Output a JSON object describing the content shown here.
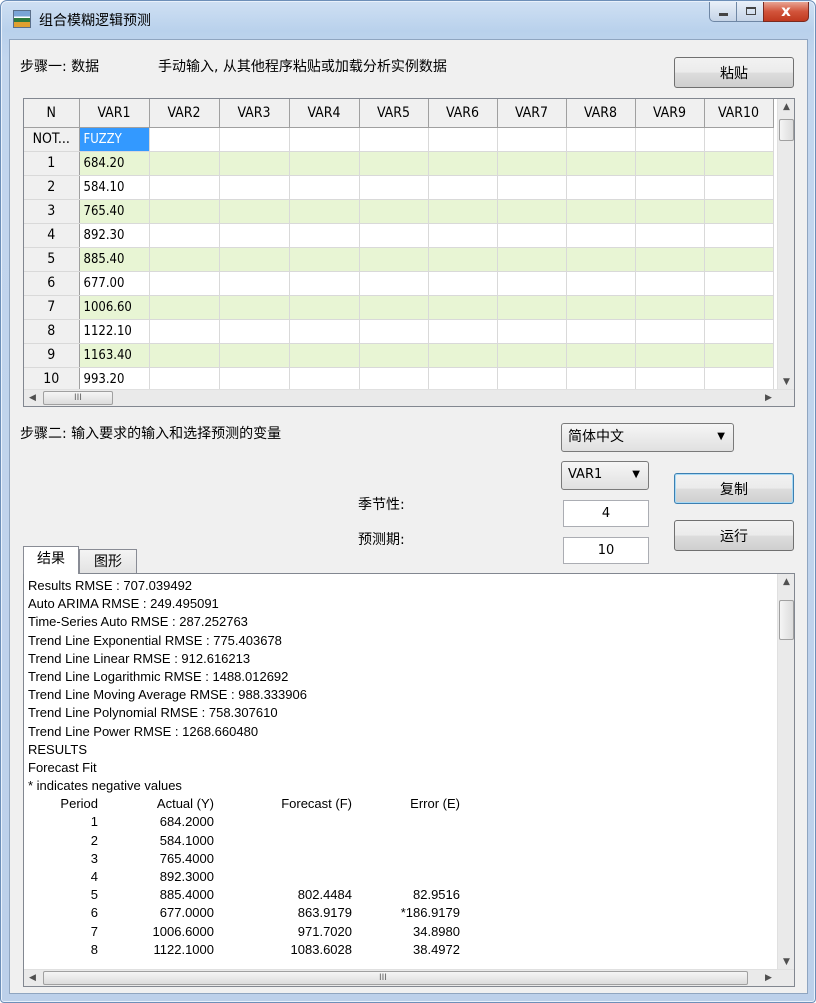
{
  "window": {
    "title": "组合模糊逻辑预测",
    "minimize": "–",
    "maximize": "□",
    "close": "x"
  },
  "step1": {
    "label": "步骤一: 数据",
    "hint": "手动输入, 从其他程序粘贴或加载分析实例数据",
    "paste_button": "粘贴"
  },
  "grid": {
    "columns": [
      "N",
      "VAR1",
      "VAR2",
      "VAR3",
      "VAR4",
      "VAR5",
      "VAR6",
      "VAR7",
      "VAR8",
      "VAR9",
      "VAR10"
    ],
    "rows": [
      {
        "n": "NOT...",
        "var1": "FUZZY"
      },
      {
        "n": "1",
        "var1": "684.20"
      },
      {
        "n": "2",
        "var1": "584.10"
      },
      {
        "n": "3",
        "var1": "765.40"
      },
      {
        "n": "4",
        "var1": "892.30"
      },
      {
        "n": "5",
        "var1": "885.40"
      },
      {
        "n": "6",
        "var1": "677.00"
      },
      {
        "n": "7",
        "var1": "1006.60"
      },
      {
        "n": "8",
        "var1": "1122.10"
      },
      {
        "n": "9",
        "var1": "1163.40"
      },
      {
        "n": "10",
        "var1": "993.20"
      }
    ],
    "alt_row_color": "#e8f5d4",
    "selected_color": "#3399ff",
    "hscroll_thumb_grip": "III"
  },
  "step2": {
    "label": "步骤二: 输入要求的输入和选择预测的变量",
    "language_select": "简体中文",
    "variable_select": "VAR1",
    "copy_button": "复制",
    "run_button": "运行",
    "seasonality_label": "季节性:",
    "seasonality_value": "4",
    "forecast_period_label": "预测期:",
    "forecast_period_value": "10"
  },
  "tabs": [
    {
      "label": "结果"
    },
    {
      "label": "图形"
    }
  ],
  "results": {
    "lines": [
      "Results RMSE : 707.039492",
      "Auto ARIMA RMSE : 249.495091",
      "Time-Series Auto RMSE : 287.252763",
      "Trend Line Exponential RMSE : 775.403678",
      "Trend Line Linear RMSE : 912.616213",
      "Trend Line Logarithmic RMSE : 1488.012692",
      "Trend Line Moving Average RMSE : 988.333906",
      "Trend Line Polynomial RMSE : 758.307610",
      "Trend Line Power RMSE : 1268.660480",
      "RESULTS",
      "Forecast Fit",
      "* indicates negative values"
    ],
    "table_header": [
      "Period",
      "Actual (Y)",
      "Forecast (F)",
      "Error (E)"
    ],
    "table_rows": [
      [
        "1",
        "684.2000",
        "",
        ""
      ],
      [
        "2",
        "584.1000",
        "",
        ""
      ],
      [
        "3",
        "765.4000",
        "",
        ""
      ],
      [
        "4",
        "892.3000",
        "",
        ""
      ],
      [
        "5",
        "885.4000",
        "802.4484",
        "82.9516"
      ],
      [
        "6",
        "677.0000",
        "863.9179",
        "*186.9179"
      ],
      [
        "7",
        "1006.6000",
        "971.7020",
        "34.8980"
      ],
      [
        "8",
        "1122.1000",
        "1083.6028",
        "38.4972"
      ]
    ],
    "hscroll_thumb_grip": "III"
  }
}
